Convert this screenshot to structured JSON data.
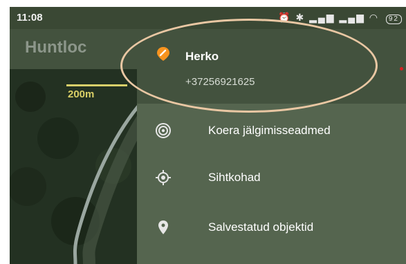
{
  "status_bar": {
    "time": "11:08",
    "battery": "92",
    "icons": [
      "alarm-icon",
      "bluetooth-icon",
      "signal-icon",
      "signal-icon",
      "wifi-icon",
      "battery-icon"
    ]
  },
  "app_bar": {
    "title": "Huntloc"
  },
  "map": {
    "scale_label": "200m"
  },
  "drawer": {
    "header": {
      "name": "Herko",
      "phone": "+37256921625",
      "icon": "orange-pin-icon"
    },
    "items": [
      {
        "label": "Koera jälgimisseadmed",
        "icon": "tracker-icon"
      },
      {
        "label": "Sihtkohad",
        "icon": "target-icon"
      },
      {
        "label": "Salvestatud objektid",
        "icon": "location-pin-icon"
      }
    ]
  },
  "colors": {
    "accent_orange": "#f7931e",
    "drawer_bg": "#55654f",
    "header_bg": "#43523e",
    "highlight_ellipse": "#e9c7a3"
  }
}
